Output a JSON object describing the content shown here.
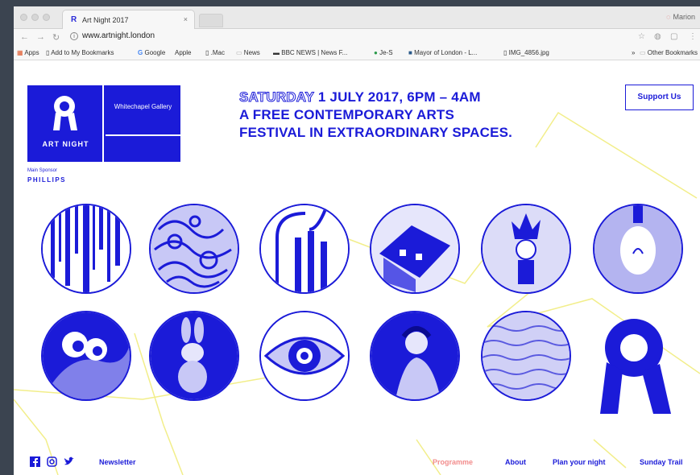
{
  "browser": {
    "tab_title": "Art Night 2017",
    "tab_close": "×",
    "profile": "Marion",
    "url": "www.artnight.london",
    "bookmarks": [
      "Apps",
      "Add to My Bookmarks",
      "Google",
      "Apple",
      ".Mac",
      "News",
      "BBC NEWS | News F...",
      "Je-S",
      "Mayor of London - L...",
      "IMG_4856.jpg",
      "»",
      "Other Bookmarks"
    ]
  },
  "logo": {
    "name": "ART NIGHT",
    "partner": "Whitechapel Gallery",
    "sponsor_label": "Main Sponsor",
    "sponsor_name": "PHILLIPS"
  },
  "headline": {
    "day": "SATURDAY",
    "date": " 1 JULY 2017, 6PM – 4AM",
    "line2": "A FREE CONTEMPORARY ARTS",
    "line3": "FESTIVAL IN EXTRAORDINARY SPACES."
  },
  "support_button": "Support Us",
  "artworks": [
    "vertical-streak-artwork",
    "swirl-pattern-artwork",
    "pipes-sculpture-artwork",
    "tilted-house-artwork",
    "flame-figure-artwork",
    "lightbulb-artwork",
    "googly-eyes-artwork",
    "balloon-rabbit-artwork",
    "eye-illustration-artwork",
    "woman-portrait-artwork",
    "water-texture-artwork"
  ],
  "footer": {
    "newsletter": "Newsletter",
    "nav": [
      "Programme",
      "About",
      "Plan your night",
      "Sunday Trail"
    ]
  },
  "colors": {
    "brand_blue": "#1b1bd8",
    "active_nav": "#f28c8c",
    "deco_line": "#f2ee8a"
  }
}
